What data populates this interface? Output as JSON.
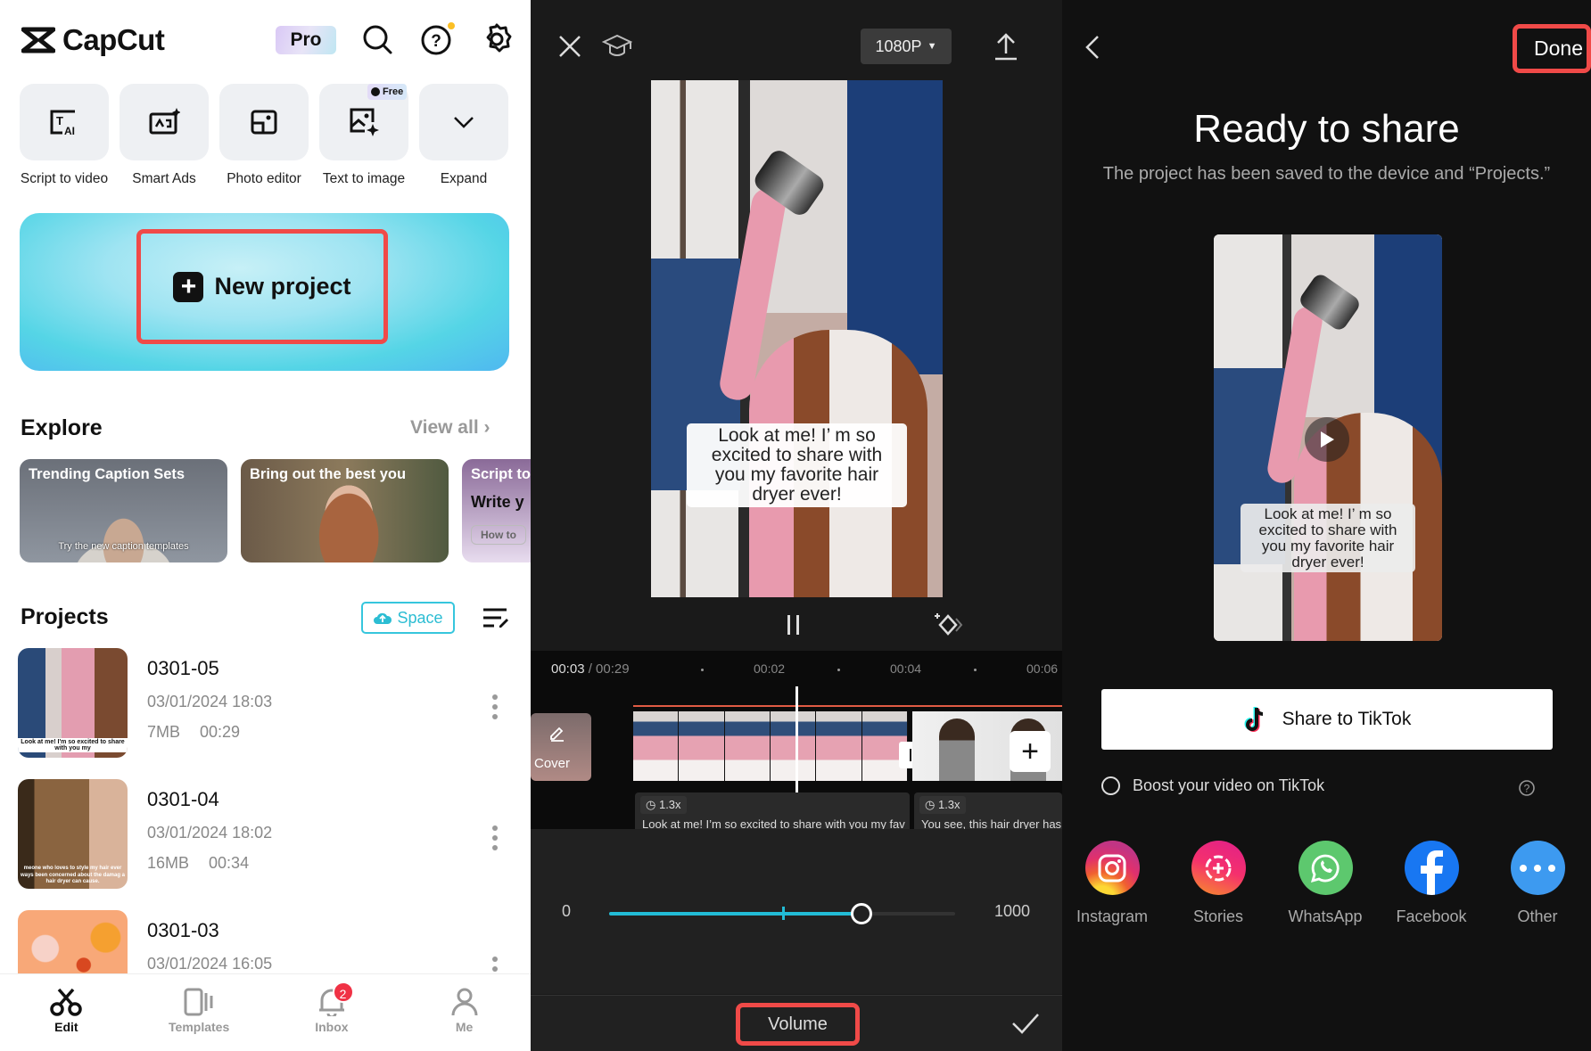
{
  "home": {
    "app_name": "CapCut",
    "pro_label": "Pro",
    "tools": [
      {
        "label": "Script to video",
        "icon": "script-ai-icon"
      },
      {
        "label": "Smart Ads",
        "icon": "smart-ads-icon"
      },
      {
        "label": "Photo editor",
        "icon": "photo-editor-icon"
      },
      {
        "label": "Text to image",
        "icon": "text-to-image-icon",
        "badge": "Free"
      },
      {
        "label": "Expand",
        "icon": "chevron-down-icon"
      }
    ],
    "new_project_label": "New project",
    "explore": {
      "title": "Explore",
      "view_all": "View all",
      "cards": [
        {
          "title": "Trending Caption Sets",
          "caption": "Try the new caption templates"
        },
        {
          "title": "Bring out the best you"
        },
        {
          "title": "Script to",
          "headline": "Write y",
          "button": "How to"
        }
      ]
    },
    "projects": {
      "title": "Projects",
      "space_label": "Space",
      "items": [
        {
          "name": "0301-05",
          "date": "03/01/2024 18:03",
          "size": "7MB",
          "duration": "00:29",
          "thumb_caption": "Look at me! I'm so excited to share with you my"
        },
        {
          "name": "0301-04",
          "date": "03/01/2024 18:02",
          "size": "16MB",
          "duration": "00:34",
          "thumb_caption": "meone who loves to style my hair ever ways been concerned about the damag a hair dryer can cause."
        },
        {
          "name": "0301-03",
          "date": "03/01/2024 16:05",
          "size": "",
          "duration": ""
        }
      ]
    },
    "nav": [
      {
        "label": "Edit",
        "active": true
      },
      {
        "label": "Templates"
      },
      {
        "label": "Inbox",
        "badge": "2"
      },
      {
        "label": "Me"
      }
    ]
  },
  "editor": {
    "resolution": "1080P",
    "caption": "Look at me! I’ m so excited to share with you my favorite hair dryer ever!",
    "time_current": "00:03",
    "time_total": "/ 00:29",
    "ticks": [
      "00:02",
      "00:04",
      "00:06"
    ],
    "cover_label": "Cover",
    "clips": [
      {
        "speed": "1.3x",
        "text": "Look at me! I’m so excited to share with you my fav"
      },
      {
        "speed": "1.3x",
        "text": "You see, this hair dryer has"
      }
    ],
    "volume": {
      "min": "0",
      "max": "1000",
      "fraction": 0.73
    },
    "tool_label": "Volume"
  },
  "share": {
    "done_label": "Done",
    "title": "Ready to share",
    "subtitle": "The project has been saved to the device and “Projects.”",
    "caption": "Look at me! I’ m so excited to share with you my favorite hair dryer ever!",
    "tiktok_label": "Share to TikTok",
    "boost_label": "Boost your video on TikTok",
    "targets": [
      {
        "label": "Instagram",
        "color": "#e1306c"
      },
      {
        "label": "Stories",
        "color": "#f5306d"
      },
      {
        "label": "WhatsApp",
        "color": "#5dc86e"
      },
      {
        "label": "Facebook",
        "color": "#1877f2"
      },
      {
        "label": "Other",
        "color": "#3d9af0"
      }
    ]
  }
}
